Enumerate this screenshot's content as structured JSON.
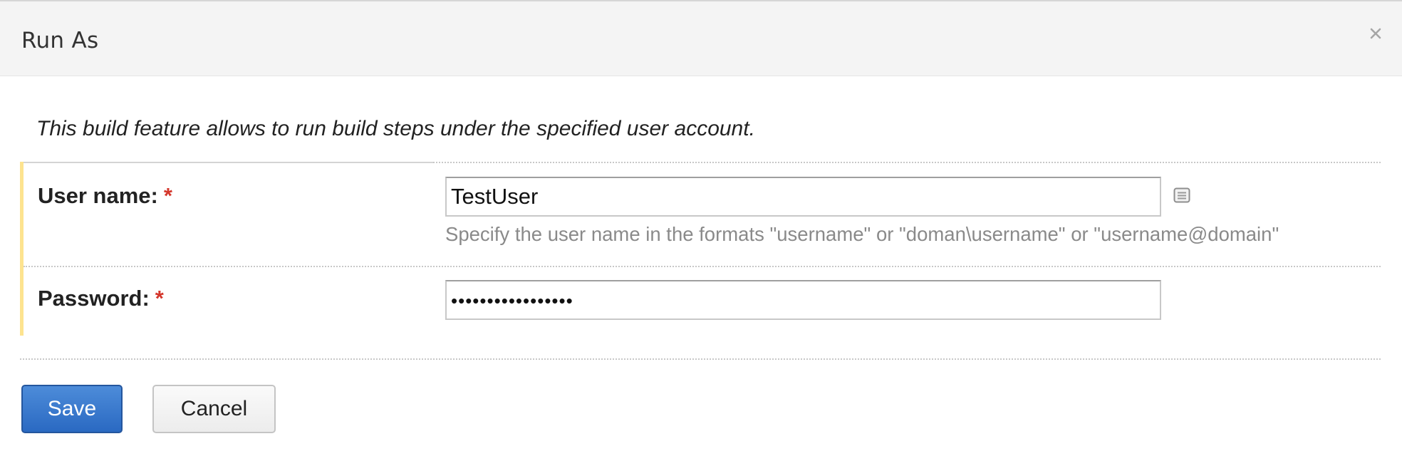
{
  "dialog": {
    "title": "Run As",
    "close_icon": "close-icon"
  },
  "description": "This build feature allows to run build steps under the specified user account.",
  "form": {
    "username": {
      "label": "User name:",
      "required": "*",
      "value": "TestUser",
      "hint": "Specify the user name in the formats \"username\" or \"doman\\username\" or \"username@domain\"",
      "side_icon": "list-icon"
    },
    "password": {
      "label": "Password:",
      "required": "*",
      "masked_value": "•••••••••••••••••"
    }
  },
  "buttons": {
    "save_label": "Save",
    "cancel_label": "Cancel"
  },
  "colors": {
    "header_bg": "#f4f4f4",
    "required_mark": "#d4372c",
    "row_accent": "#fde38f",
    "save_button": "#2a69c2"
  }
}
